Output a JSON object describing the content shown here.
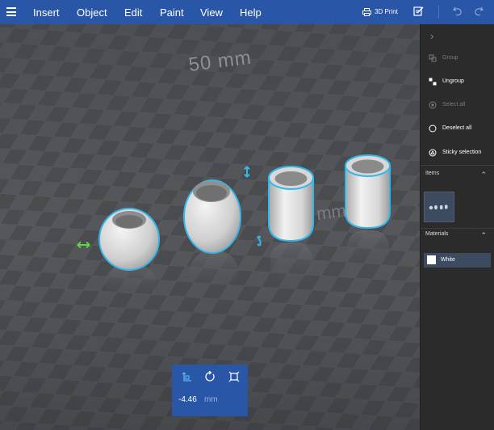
{
  "menubar": {
    "items": [
      {
        "label": "Insert"
      },
      {
        "label": "Object"
      },
      {
        "label": "Edit"
      },
      {
        "label": "Paint"
      },
      {
        "label": "View"
      },
      {
        "label": "Help"
      }
    ],
    "print_label": "3D Print",
    "icons": [
      "hamburger-menu-icon",
      "printer-icon",
      "mark-up-icon",
      "undo-icon",
      "redo-icon"
    ]
  },
  "viewport": {
    "ruler_label": "50 mm",
    "ruler_label_faded": "mm",
    "objects": [
      "sphere-vase",
      "egg-vase",
      "cylinder-cup-1",
      "cylinder-cup-2"
    ]
  },
  "transform_panel": {
    "value": "-4.46",
    "unit": "mm",
    "icons": [
      "move-icon",
      "rotate-icon",
      "scale-icon"
    ]
  },
  "sidepanel": {
    "actions": [
      {
        "label": "Group",
        "enabled": false
      },
      {
        "label": "Ungroup",
        "enabled": true
      },
      {
        "label": "Select all",
        "enabled": false
      },
      {
        "label": "Deselect all",
        "enabled": true
      },
      {
        "label": "Sticky selection",
        "enabled": true
      }
    ],
    "items_title": "Items",
    "materials_title": "Materials",
    "materials": [
      {
        "label": "White",
        "color": "#ffffff"
      }
    ]
  },
  "colors": {
    "accent": "#2a56a8",
    "panel_bg": "#2b2b2b",
    "selection_outline": "#35b6ea",
    "move_arrow": "#5fd34a"
  }
}
